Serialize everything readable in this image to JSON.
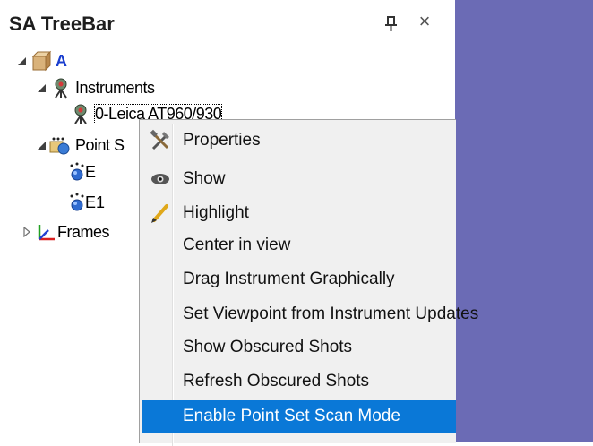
{
  "panel": {
    "title": "SA TreeBar",
    "pin_icon": "pin-icon",
    "close_label": "×"
  },
  "tree": {
    "root": {
      "label": "A",
      "icon": "package-icon",
      "color": "#1b3fcf"
    },
    "instruments": {
      "label": "Instruments",
      "icon": "instrument-icon"
    },
    "instrument_item": {
      "label": "0-Leica AT960/930",
      "icon": "instrument-icon"
    },
    "point_sets": {
      "label": "Point S",
      "icon": "point-set-icon"
    },
    "point_e": {
      "label": "E",
      "icon": "point-icon"
    },
    "point_e1": {
      "label": "E1",
      "icon": "point-icon"
    },
    "frames": {
      "label": "Frames",
      "icon": "frames-icon"
    }
  },
  "context_menu": {
    "items": [
      {
        "label": "Properties",
        "icon": "tools-icon",
        "selected": false
      },
      {
        "label": "Show",
        "icon": "eye-icon",
        "selected": false
      },
      {
        "label": "Highlight",
        "icon": "pencil-icon",
        "selected": false
      },
      {
        "label": "Center in view",
        "icon": "",
        "selected": false
      },
      {
        "label": "Drag Instrument Graphically",
        "icon": "",
        "selected": false
      },
      {
        "label": "Set Viewpoint from Instrument Updates",
        "icon": "",
        "selected": false
      },
      {
        "label": "Show Obscured Shots",
        "icon": "",
        "selected": false
      },
      {
        "label": "Refresh Obscured Shots",
        "icon": "",
        "selected": false
      },
      {
        "label": "Enable Point Set Scan Mode",
        "icon": "",
        "selected": true
      }
    ],
    "selection_color": "#0a78d7"
  },
  "colors": {
    "viewport_bg": "#6b6bb5",
    "menu_bg": "#f0f0f0"
  }
}
